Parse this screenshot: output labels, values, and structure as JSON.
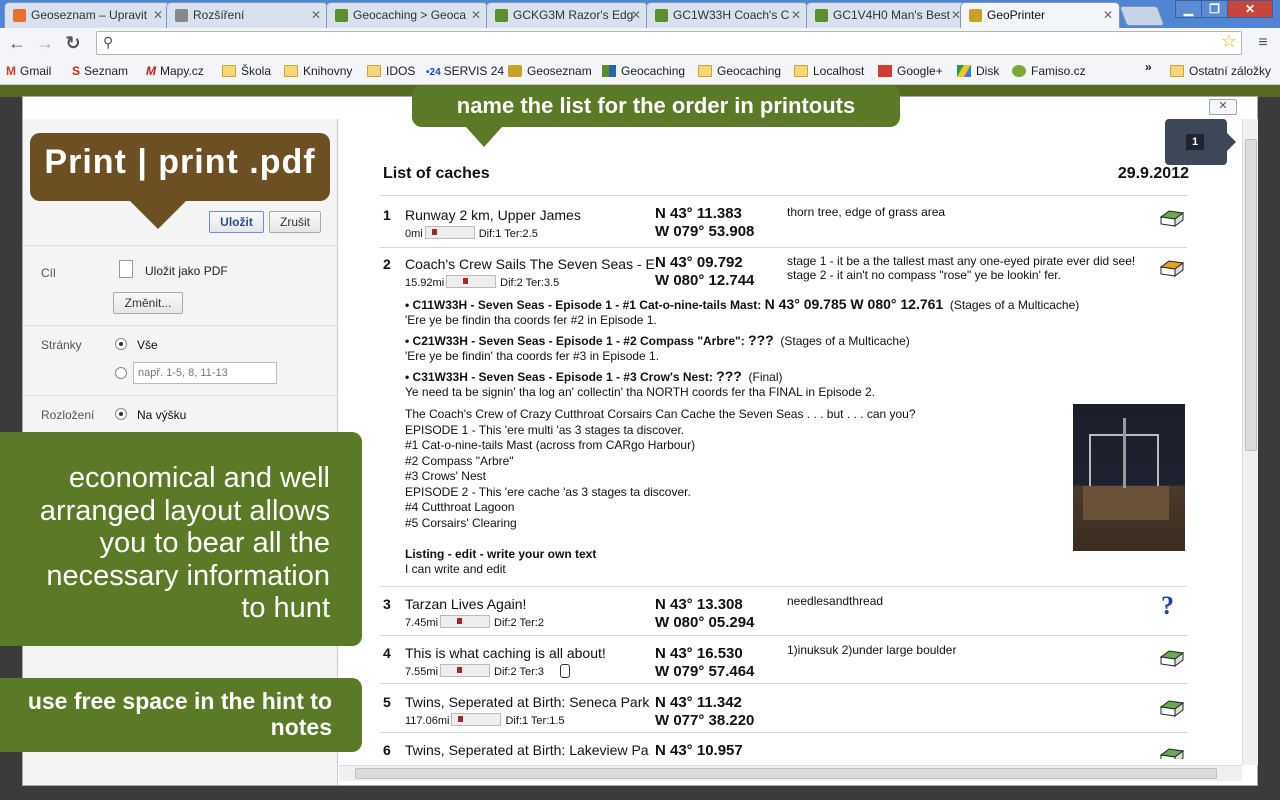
{
  "browser": {
    "tabs": [
      {
        "title": "Geoseznam – Upravit",
        "color": "#e86f2c"
      },
      {
        "title": "Rozšíření",
        "color": "#888888"
      },
      {
        "title": "Geocaching > Geoca",
        "color": "#5a8f2b"
      },
      {
        "title": "GCKG3M Razor's Edg",
        "color": "#5a8f2b"
      },
      {
        "title": "GC1W33H Coach's C",
        "color": "#5a8f2b"
      },
      {
        "title": "GC1V4H0 Man's Best",
        "color": "#5a8f2b"
      },
      {
        "title": "GeoPrinter",
        "color": "#c8a12a"
      }
    ],
    "bookmarks": [
      {
        "label": "Gmail",
        "icon": "gmail-icon"
      },
      {
        "label": "Seznam",
        "icon": "seznam-icon"
      },
      {
        "label": "Mapy.cz",
        "icon": "mapy-icon"
      },
      {
        "label": "Škola",
        "icon": "folder-icon"
      },
      {
        "label": "Knihovny",
        "icon": "folder-icon"
      },
      {
        "label": "IDOS",
        "icon": "folder-icon"
      },
      {
        "label": "SERVIS 24",
        "icon": "servis-icon"
      },
      {
        "label": "Geoseznam",
        "icon": "geoseznam-icon"
      },
      {
        "label": "Geocaching",
        "icon": "geocaching-icon"
      },
      {
        "label": "Geocaching",
        "icon": "folder-icon"
      },
      {
        "label": "Localhost",
        "icon": "folder-icon"
      },
      {
        "label": "Google+",
        "icon": "googleplus-icon"
      },
      {
        "label": "Disk",
        "icon": "drive-icon"
      },
      {
        "label": "Famiso.cz",
        "icon": "famiso-icon"
      }
    ],
    "other_bookmarks": "Ostatní záložky",
    "more_bookmarks": "»"
  },
  "sidebar": {
    "save_button": "Uložit",
    "cancel_button": "Zrušit",
    "destination_label": "Cíl",
    "destination_value": "Uložit jako PDF",
    "change_button": "Změnit...",
    "pages_label": "Stránky",
    "pages_all": "Vše",
    "pages_placeholder": "např. 1-5, 8, 11-13",
    "layout_label": "Rozložení",
    "layout_value": "Na výšku"
  },
  "document": {
    "title": "List of caches",
    "date": "29.9.2012",
    "page_badge": "1",
    "caches": [
      {
        "num": "1",
        "name": "Runway 2 km, Upper James",
        "distance": "0mi",
        "diff": "Dif:1",
        "terr": "Ter:2.5",
        "lat": "N 43° 11.383",
        "lon": "W 079° 53.908",
        "hint": "thorn tree, edge of grass area"
      },
      {
        "num": "2",
        "name": "Coach's Crew Sails The Seven Seas - E",
        "distance": "15.92mi",
        "diff": "Dif:2",
        "terr": "Ter:3.5",
        "lat": "N 43° 09.792",
        "lon": "W 080° 12.744",
        "hint": "stage 1 - it be a the tallest mast any one-eyed pirate ever did see! stage 2 - it ain't no compass \"rose\" ye be lookin' fer."
      },
      {
        "num": "3",
        "name": "Tarzan Lives Again!",
        "distance": "7.45mi",
        "diff": "Dif:2",
        "terr": "Ter:2",
        "lat": "N 43° 13.308",
        "lon": "W 080° 05.294",
        "hint": "needlesandthread"
      },
      {
        "num": "4",
        "name": "This is what caching is all about!",
        "distance": "7.55mi",
        "diff": "Dif:2",
        "terr": "Ter:3",
        "lat": "N 43° 16.530",
        "lon": "W 079° 57.464",
        "hint": "1)inuksuk 2)under large boulder"
      },
      {
        "num": "5",
        "name": "Twins, Seperated at Birth: Seneca Park",
        "distance": "117.06mi",
        "diff": "Dif:1",
        "terr": "Ter:1.5",
        "lat": "N 43° 11.342",
        "lon": "W 077° 38.220",
        "hint": ""
      },
      {
        "num": "6",
        "name": "Twins, Seperated at Birth: Lakeview Pa",
        "distance": "",
        "diff": "",
        "terr": "",
        "lat": "N 43° 10.957",
        "lon": "",
        "hint": ""
      }
    ],
    "stages": [
      {
        "code": "• C11W33H - Seven Seas - Episode 1 - #1 Cat-o-nine-tails Mast:",
        "coords": "N 43° 09.785 W 080° 12.761",
        "type": "(Stages of a Multicache)",
        "text": "'Ere ye be findin tha coords fer #2 in Episode 1."
      },
      {
        "code": "• C21W33H - Seven Seas - Episode 1 - #2 Compass \"Arbre\":",
        "coords": "???",
        "type": "(Stages of a Multicache)",
        "text": "'Ere ye be findin' tha coords fer #3 in Episode 1."
      },
      {
        "code": "• C31W33H - Seven Seas - Episode 1 - #3 Crow's Nest:",
        "coords": "???",
        "type": "(Final)",
        "text": "Ye need ta be signin' tha log an' collectin' tha NORTH coords fer tha FINAL in Episode 2."
      }
    ],
    "description": [
      "The Coach's Crew of Crazy Cutthroat Corsairs Can Cache the Seven Seas . . . but . . . can you?",
      "EPISODE 1 - This 'ere multi 'as 3 stages ta discover.",
      "#1 Cat-o-nine-tails Mast (across from CARgo Harbour)",
      "#2 Compass \"Arbre\"",
      "#3 Crows' Nest",
      "EPISODE 2 - This 'ere cache 'as 3 stages ta discover.",
      "#4 Cutthroat Lagoon",
      "#5 Corsairs' Clearing"
    ],
    "notes_title": "Listing - edit - write your own text",
    "notes_text": "I can write and edit"
  },
  "callouts": {
    "print": "Print | print .pdf",
    "name_list": "name the list for the order in printouts",
    "layout": "economical and well arranged layout allows  you to bear all the necessary information to hunt",
    "hint": "use free space in the hint to notes"
  },
  "colors": {
    "callout_green": "#5b7a27",
    "callout_brown": "#6d4f24",
    "chrome_blue": "#4f85d2"
  }
}
